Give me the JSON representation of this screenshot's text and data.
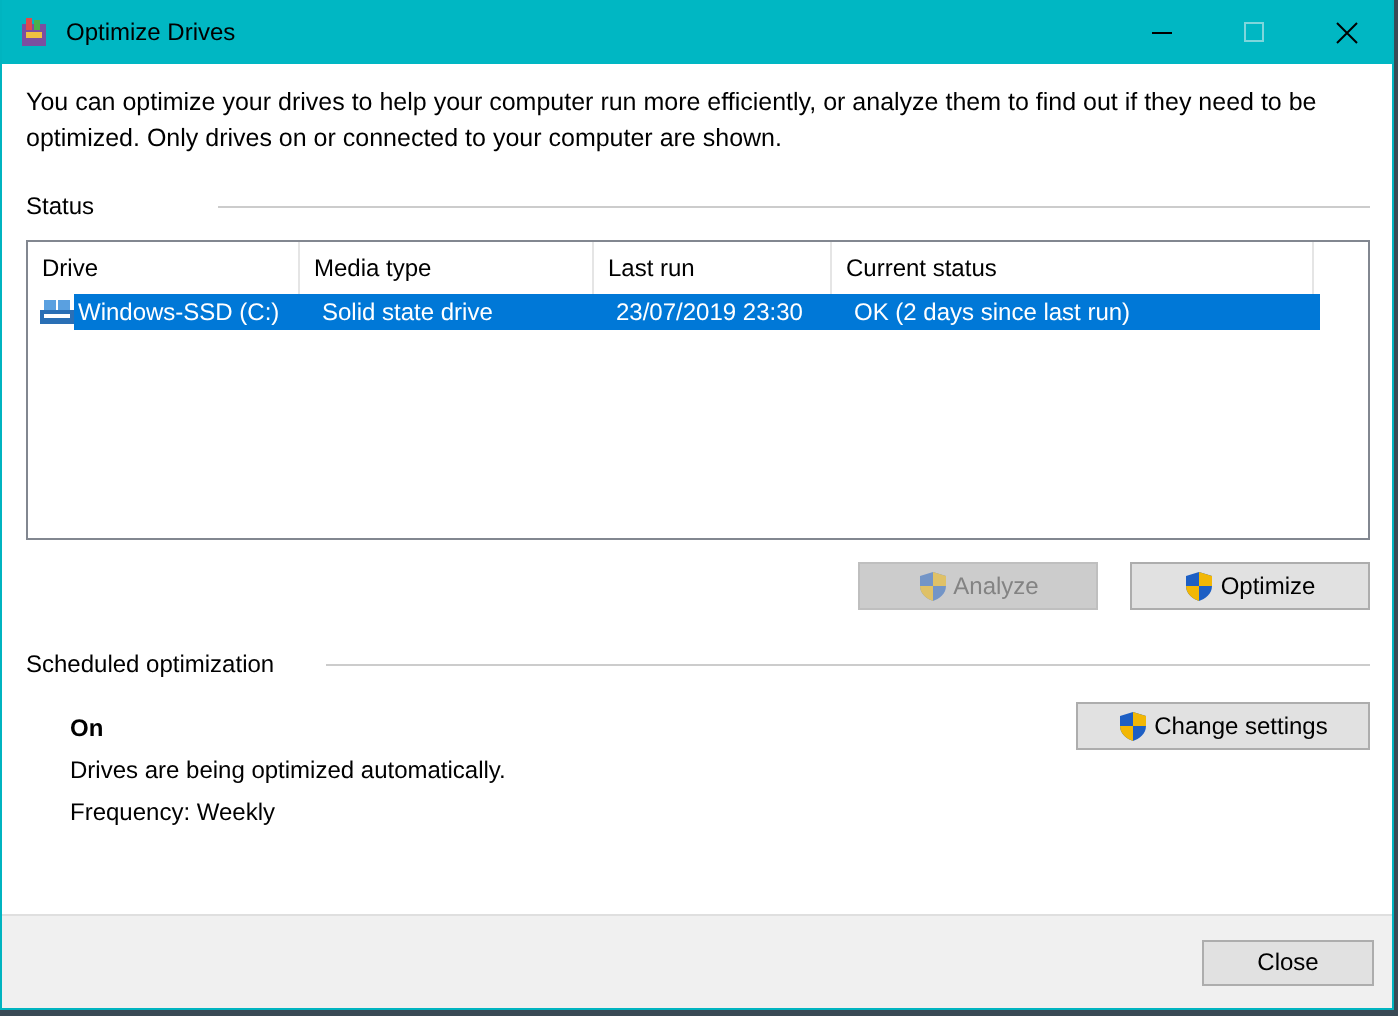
{
  "window": {
    "title": "Optimize Drives"
  },
  "description": "You can optimize your drives to help your computer run more efficiently, or analyze them to find out if they need to be optimized. Only drives on or connected to your computer are shown.",
  "status": {
    "heading": "Status",
    "columns": [
      "Drive",
      "Media type",
      "Last run",
      "Current status"
    ],
    "rows": [
      {
        "cells": [
          "Windows-SSD (C:)",
          "Solid state drive",
          "23/07/2019 23:30",
          "OK (2 days since last run)"
        ],
        "selected": true
      }
    ],
    "buttons": [
      {
        "label": "Analyze",
        "disabled": true
      },
      {
        "label": "Optimize",
        "disabled": false
      }
    ]
  },
  "scheduled": {
    "heading": "Scheduled optimization",
    "state": "On",
    "lines": [
      "Drives are being optimized automatically.",
      "Frequency: Weekly"
    ],
    "button": {
      "label": "Change settings",
      "disabled": false
    }
  },
  "footer": {
    "button": "Close"
  }
}
